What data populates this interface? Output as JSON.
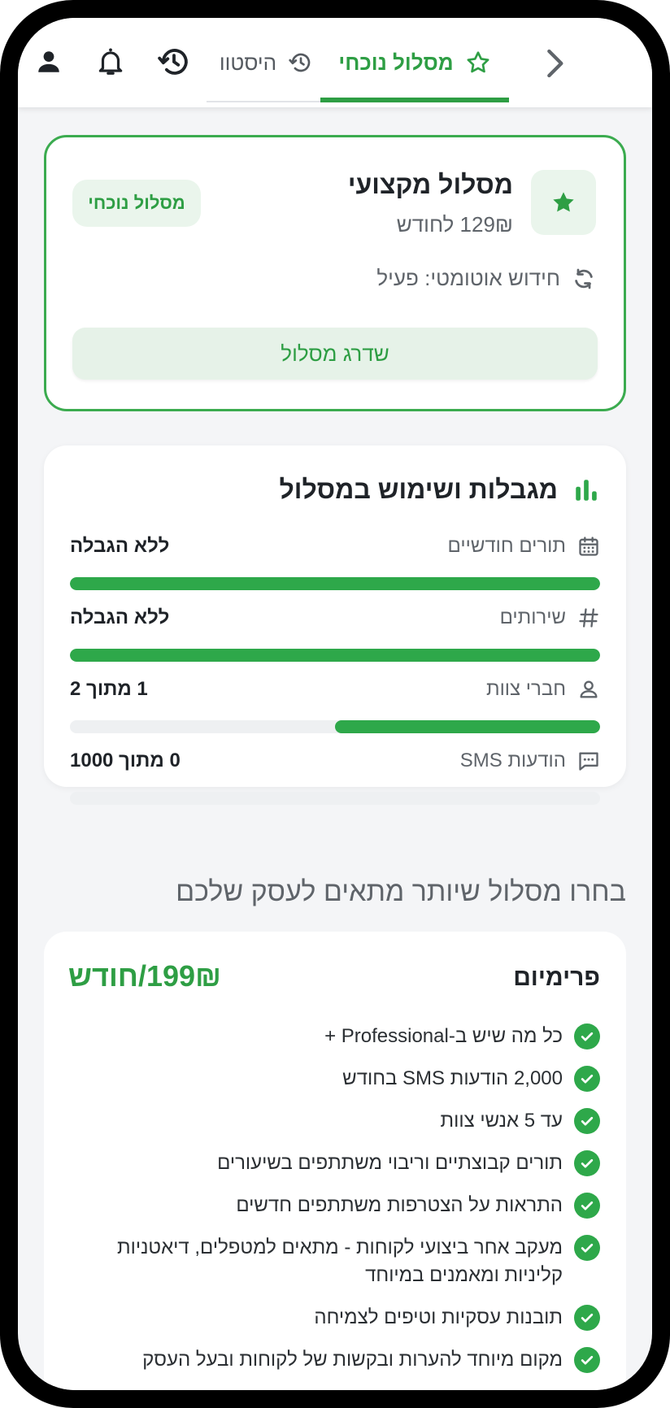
{
  "tabs": {
    "current": "מסלול נוכחי",
    "history": "היסטוו"
  },
  "current_plan": {
    "name": "מסלול מקצועי",
    "price": "129₪ לחודש",
    "badge": "מסלול נוכחי",
    "auto_renew": "חידוש אוטומטי: פעיל",
    "upgrade_button": "שדרג מסלול"
  },
  "limits": {
    "title": "מגבלות ושימוש במסלול",
    "items": [
      {
        "label": "תורים חודשיים",
        "value": "ללא הגבלה",
        "icon": "calendar-icon",
        "fill_fraction": 1.0
      },
      {
        "label": "שירותים",
        "value": "ללא הגבלה",
        "icon": "hash-icon",
        "fill_fraction": 1.0
      },
      {
        "label": "חברי צוות",
        "value": "1 מתוך 2",
        "icon": "person-icon",
        "fill_fraction": 0.5
      },
      {
        "label": "הודעות SMS",
        "value": "0 מתוך 1000",
        "icon": "message-icon",
        "fill_fraction": 0.0
      }
    ]
  },
  "upgrade_section": {
    "title": "בחרו מסלול שיותר מתאים לעסק שלכם"
  },
  "premium": {
    "name": "פרימיום",
    "price": "199₪/חודש",
    "features": [
      "כל מה שיש ב-Professional +",
      "2,000 הודעות SMS בחודש",
      "עד 5 אנשי צוות",
      "תורים קבוצתיים וריבוי משתתפים בשיעורים",
      "התראות על הצטרפות משתתפים חדשים",
      "מעקב אחר ביצועי לקוחות - מתאים למטפלים, דיאטניות קליניות ומאמנים במיוחד",
      "תובנות עסקיות וטיפים לצמיחה",
      "מקום מיוחד להערות ובקשות של לקוחות ובעל העסק"
    ]
  },
  "colors": {
    "accent": "#2e9e44",
    "accent_light": "#eaf5ec",
    "bar_track": "#eef0f2",
    "text_dark": "#1f2328",
    "text_muted": "#5f646a"
  }
}
